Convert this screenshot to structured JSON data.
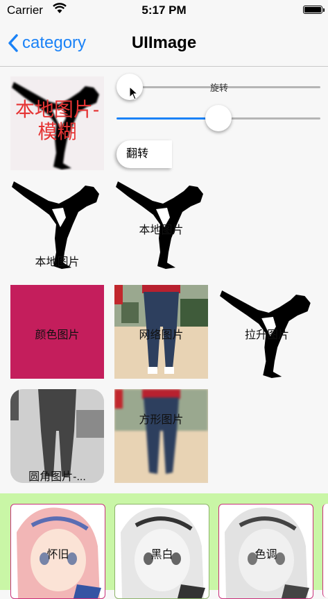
{
  "status_bar": {
    "carrier": "Carrier",
    "time": "5:17 PM"
  },
  "nav": {
    "back_label": "category",
    "title": "UIImage"
  },
  "controls": {
    "rotate_label": "旋转",
    "flip_label": "翻转",
    "rotate_slider_value": 0.0,
    "blur_slider_value": 0.5
  },
  "tiles": {
    "local_blur": "本地图片-模糊",
    "local_1": "本地图片",
    "local_2": "本地图片",
    "color": "颜色图片",
    "network": "网络图片",
    "stretch": "拉升图片",
    "rounded": "圆角图片-...",
    "square": "方形图片"
  },
  "filters": {
    "nostalgia": "怀旧",
    "black_white": "黑白",
    "hue": "色调"
  },
  "colors": {
    "accent": "#1a82f7",
    "tile_pink": "#c41e5c",
    "bottom_bg": "#c9f6a6",
    "blur_text": "#e53333"
  }
}
